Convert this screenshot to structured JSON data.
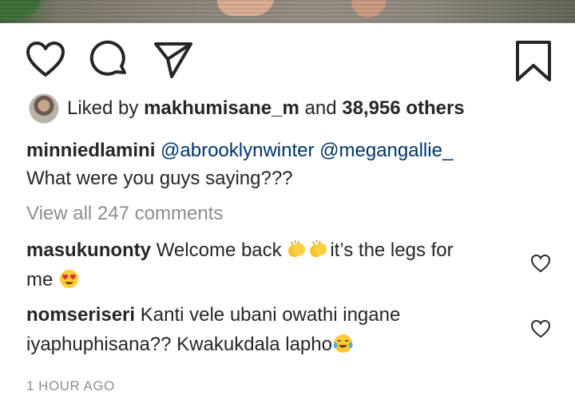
{
  "post": {
    "actions": {
      "like_icon": "heart-outline-icon",
      "comment_icon": "comment-bubble-icon",
      "share_icon": "paper-plane-icon",
      "save_icon": "bookmark-icon"
    },
    "likes": {
      "prefix": "Liked by",
      "user": "makhumisane_m",
      "conjunction": "and",
      "others": "38,956 others"
    },
    "caption": {
      "username": "minniedlamini",
      "mention1": "@abrooklynwinter",
      "mention2": "@megangallie_",
      "text": "What were you guys saying???"
    },
    "view_all": "View all 247 comments",
    "comments": [
      {
        "username": "masukunonty",
        "text_part1": "Welcome back",
        "text_part2": "it’s the legs for",
        "text_line2": "me"
      },
      {
        "username": "nomseriseri",
        "text_line1": "Kanti vele ubani owathi ingane",
        "text_line2": "iyaphuphisana?? Kwakukdala lapho"
      }
    ],
    "timestamp": "1 HOUR AGO"
  },
  "colors": {
    "text": "#262626",
    "muted": "#8e8e8e",
    "mention": "#003569"
  }
}
